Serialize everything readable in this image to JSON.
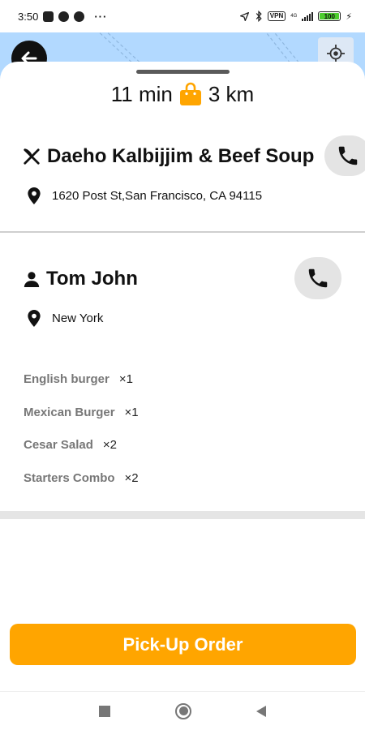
{
  "status_bar": {
    "time": "3:50",
    "vpn": "VPN",
    "network": "4G",
    "battery": "100"
  },
  "eta": {
    "time": "11 min",
    "distance": "3 km"
  },
  "restaurant": {
    "name": "Daeho Kalbijjim & Beef Soup",
    "address": "1620 Post St,San Francisco, CA 94115"
  },
  "customer": {
    "name": "Tom John",
    "location": "New York"
  },
  "order_items": [
    {
      "name": "English burger",
      "qty": "×1"
    },
    {
      "name": "Mexican Burger",
      "qty": "×1"
    },
    {
      "name": "Cesar Salad",
      "qty": "×2"
    },
    {
      "name": "Starters Combo",
      "qty": "×2"
    }
  ],
  "actions": {
    "pickup_label": "Pick-Up Order"
  },
  "colors": {
    "accent": "#ffa500",
    "map": "#b2d9ff",
    "battery": "#4ccd2e"
  },
  "icons": [
    "back-arrow-icon",
    "locate-icon",
    "bag-icon",
    "utensils-icon",
    "phone-icon",
    "location-pin-icon",
    "person-icon"
  ]
}
